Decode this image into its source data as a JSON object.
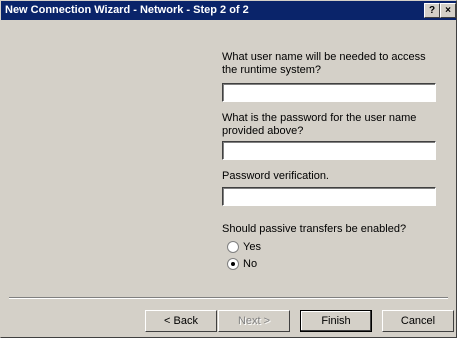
{
  "window": {
    "title": "New Connection Wizard - Network - Step 2 of 2",
    "help_glyph": "?",
    "close_glyph": "×"
  },
  "form": {
    "username_label": "What user name will be needed to access the runtime system?",
    "username_value": "",
    "password_label": "What is the password for the user name provided above?",
    "password_value": "",
    "verify_label": "Password verification.",
    "verify_value": "",
    "passive_label": "Should passive transfers be enabled?",
    "options": [
      {
        "label": "Yes",
        "checked": false
      },
      {
        "label": "No",
        "checked": true
      }
    ]
  },
  "buttons": {
    "back": "< Back",
    "next": "Next >",
    "finish": "Finish",
    "cancel": "Cancel"
  }
}
